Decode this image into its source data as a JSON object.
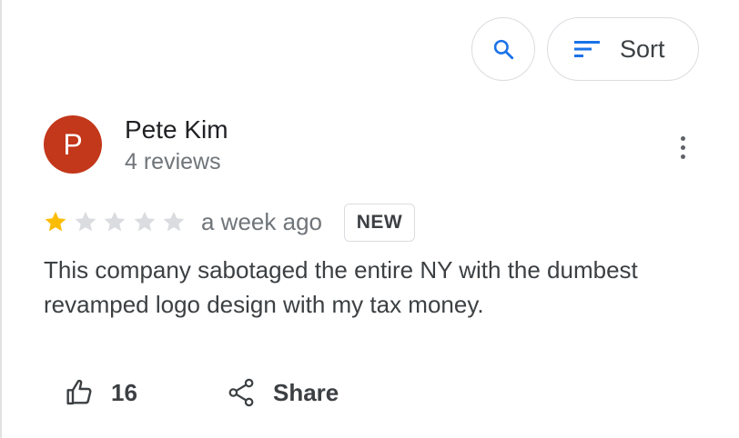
{
  "toolbar": {
    "search_icon": "search-icon",
    "sort_icon": "sort-lines-icon",
    "sort_label": "Sort"
  },
  "review": {
    "avatar_initial": "P",
    "avatar_color": "#c3371a",
    "reviewer_name": "Pete Kim",
    "reviewer_meta": "4 reviews",
    "rating": 1,
    "rating_max": 5,
    "star_filled_color": "#fbbc04",
    "star_empty_color": "#dadce0",
    "time": "a week ago",
    "badge": "NEW",
    "text": "This company sabotaged the entire NY with the dumbest revamped logo design with my tax money.",
    "likes": "16",
    "share_label": "Share"
  },
  "colors": {
    "accent_blue": "#1a73e8",
    "text_primary": "#202124",
    "text_secondary": "#70757a"
  }
}
